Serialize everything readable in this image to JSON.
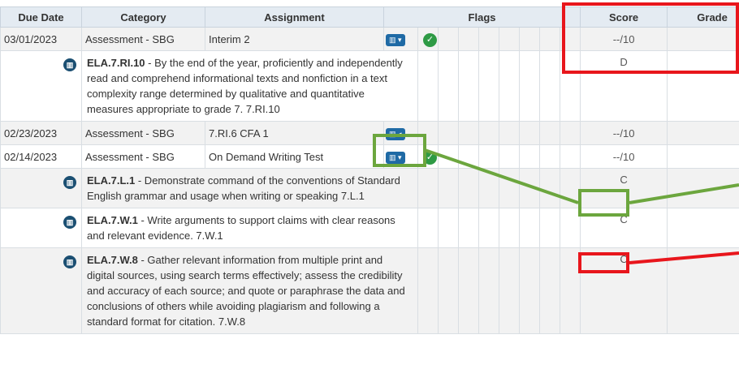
{
  "headers": {
    "due_date": "Due Date",
    "category": "Category",
    "assignment": "Assignment",
    "flags": "Flags",
    "score": "Score",
    "grade": "Grade"
  },
  "rows": [
    {
      "due": "03/01/2023",
      "category": "Assessment - SBG",
      "assignment": "Interim 2",
      "score": "--/10",
      "flag_state": "collapsed",
      "completed": true
    },
    {
      "due": "02/23/2023",
      "category": "Assessment - SBG",
      "assignment": "7.RI.6 CFA 1",
      "score": "--/10",
      "flag_state": "expanded",
      "completed": false
    },
    {
      "due": "02/14/2023",
      "category": "Assessment - SBG",
      "assignment": "On Demand Writing Test",
      "score": "--/10",
      "flag_state": "collapsed",
      "completed": true
    }
  ],
  "standards": [
    {
      "code": "ELA.7.RI.10",
      "text": " - By the end of the year, proficiently and independently read and comprehend informational texts and nonfiction in a text complexity range determined by qualitative and quantitative measures appropriate to grade 7. 7.RI.10",
      "score": "D"
    },
    {
      "code": "ELA.7.L.1",
      "text": " - Demonstrate command of the conventions of Standard English grammar and usage when writing or speaking 7.L.1",
      "score": "C"
    },
    {
      "code": "ELA.7.W.1",
      "text": " - Write arguments to support claims with clear reasons and relevant evidence. 7.W.1",
      "score": "C"
    },
    {
      "code": "ELA.7.W.8",
      "text": " - Gather relevant information from multiple print and digital sources, using search terms effectively; assess the credibility and accuracy of each source; and quote or paraphrase the data and conclusions of others while avoiding plagiarism and following a standard format for citation. 7.W.8",
      "score": "C"
    }
  ],
  "icons": {
    "standard": "standards-chart-icon",
    "flag_menu": "chart-dropdown-icon",
    "check": "check-circle-icon"
  },
  "colors": {
    "annotation_red": "#e8161c",
    "annotation_green": "#6ca63e",
    "header_bg": "#e4ebf2",
    "flag_button": "#1f6aa5"
  }
}
